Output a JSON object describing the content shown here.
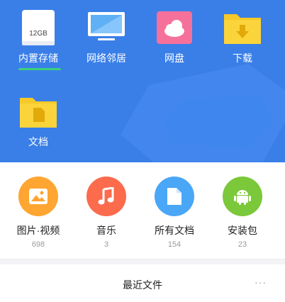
{
  "storage_tiles": [
    {
      "label": "内置存储",
      "capacity": "12GB"
    },
    {
      "label": "网络邻居"
    },
    {
      "label": "网盘"
    },
    {
      "label": "下载"
    },
    {
      "label": "文档"
    }
  ],
  "categories": [
    {
      "name": "图片·视频",
      "count": "698"
    },
    {
      "name": "音乐",
      "count": "3"
    },
    {
      "name": "所有文档",
      "count": "154"
    },
    {
      "name": "安装包",
      "count": "23"
    }
  ],
  "recent": {
    "title": "最近文件",
    "more": "···"
  },
  "colors": {
    "hero_bg": "#3a7fe8",
    "active_underline": "#3cd17a",
    "photos": "#ffa531",
    "music": "#fb6b4c",
    "docs": "#4aa6f7",
    "apk": "#7bc83a"
  }
}
